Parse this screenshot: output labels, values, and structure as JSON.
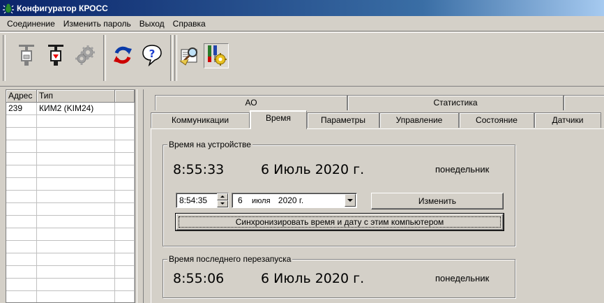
{
  "window": {
    "title": "Конфигуратор КРОСС"
  },
  "menu": [
    "Соединение",
    "Изменить пароль",
    "Выход",
    "Справка"
  ],
  "toolbar": {
    "buttons": [
      "connect-device",
      "disconnect-device",
      "settings",
      "refresh",
      "help",
      "search-config",
      "configure-device"
    ]
  },
  "devices": {
    "columns": [
      "Адрес",
      "Тип"
    ],
    "rows": [
      {
        "address": "239",
        "type": "КИМ2 (KIM24)"
      }
    ]
  },
  "tabs": {
    "top_row": [
      "АО",
      "Статистика"
    ],
    "bottom_row": [
      "Коммуникации",
      "Время",
      "Параметры",
      "Управление",
      "Состояние",
      "Датчики"
    ],
    "active": "Время"
  },
  "device_time": {
    "legend": "Время на устройстве",
    "time": "8:55:33",
    "date": "6 Июль 2020 г.",
    "weekday": "понедельник",
    "edit_time": "8:54:35",
    "edit_day": "6",
    "edit_month": "июля",
    "edit_year": "2020 г.",
    "change_label": "Изменить",
    "sync_label": "Синхронизировать время и дату с этим компьютером"
  },
  "restart_time": {
    "legend": "Время последнего перезапуска",
    "time": "8:55:06",
    "date": "6 Июль 2020 г.",
    "weekday": "понедельник"
  }
}
